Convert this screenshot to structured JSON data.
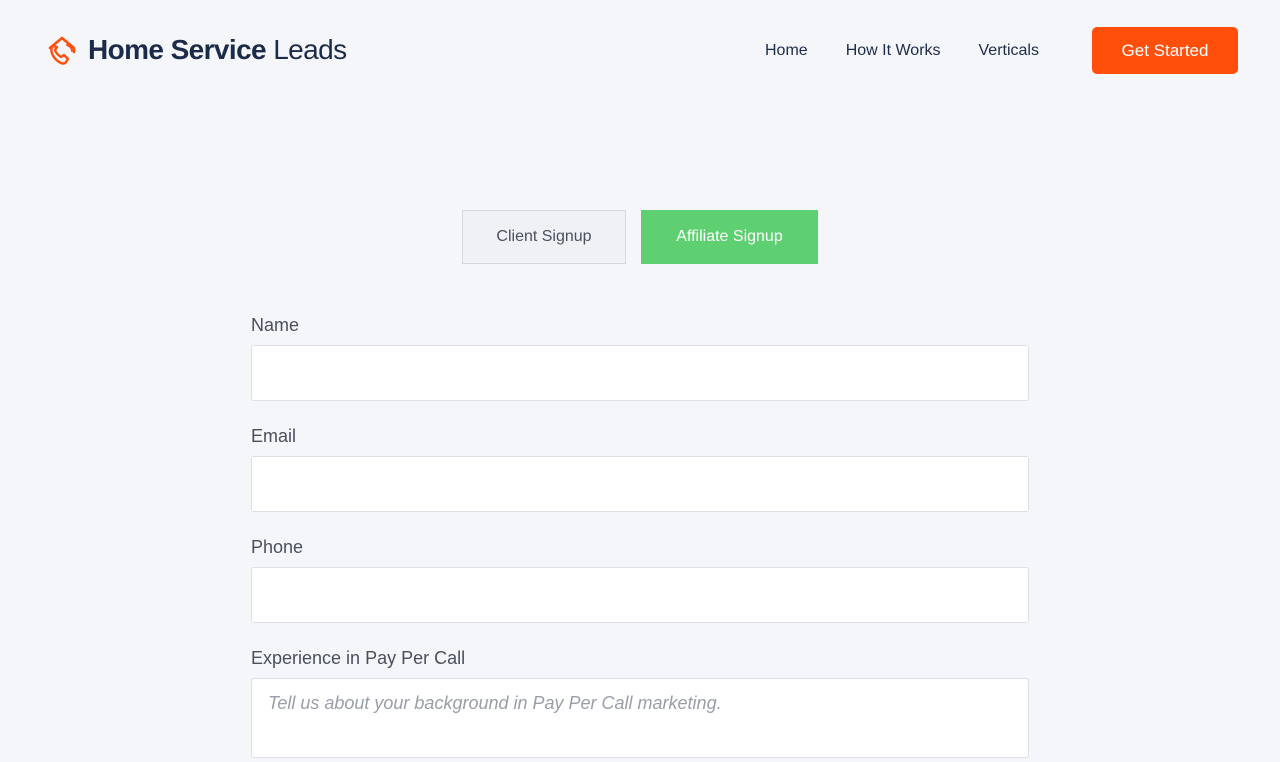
{
  "brand": {
    "name_strong": "Home Service",
    "name_light": "Leads",
    "icon": "house-phone-icon",
    "accent_color": "#ff4f0a",
    "text_color": "#1c2b4a"
  },
  "nav": {
    "items": [
      {
        "label": "Home"
      },
      {
        "label": "How It Works"
      },
      {
        "label": "Verticals"
      }
    ],
    "cta_label": "Get Started"
  },
  "tabs": {
    "client_label": "Client Signup",
    "affiliate_label": "Affiliate Signup",
    "active": "Affiliate Signup",
    "active_color": "#5fd072"
  },
  "form": {
    "name": {
      "label": "Name",
      "value": ""
    },
    "email": {
      "label": "Email",
      "value": ""
    },
    "phone": {
      "label": "Phone",
      "value": ""
    },
    "experience": {
      "label": "Experience in Pay Per Call",
      "placeholder": "Tell us about your background in Pay Per Call marketing.",
      "value": ""
    }
  }
}
